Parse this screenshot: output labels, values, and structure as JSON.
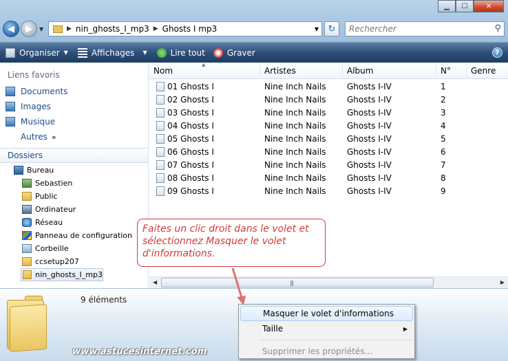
{
  "window": {
    "controls": {
      "minimize": "▁",
      "maximize": "☐",
      "close": "✕"
    }
  },
  "address": {
    "crumbs": [
      "nin_ghosts_I_mp3",
      "Ghosts I mp3"
    ]
  },
  "search": {
    "placeholder": "Rechercher"
  },
  "toolbar": {
    "organize": "Organiser",
    "views": "Affichages",
    "play_all": "Lire tout",
    "burn": "Graver",
    "help": "?"
  },
  "sidebar": {
    "favorites_title": "Liens favoris",
    "favorites": [
      "Documents",
      "Images",
      "Musique"
    ],
    "more": "Autres",
    "folders_title": "Dossiers",
    "tree": [
      {
        "label": "Bureau",
        "icon": "desktop-icon"
      },
      {
        "label": "Sebastien",
        "icon": "user-icon"
      },
      {
        "label": "Public",
        "icon": "folder-icon"
      },
      {
        "label": "Ordinateur",
        "icon": "computer-icon"
      },
      {
        "label": "Réseau",
        "icon": "network-icon"
      },
      {
        "label": "Panneau de configuration",
        "icon": "control-panel-icon"
      },
      {
        "label": "Corbeille",
        "icon": "recycle-bin-icon"
      },
      {
        "label": "ccsetup207",
        "icon": "folder-icon"
      },
      {
        "label": "nin_ghosts_I_mp3",
        "icon": "folder-icon",
        "selected": true
      }
    ]
  },
  "list": {
    "columns": [
      "Nom",
      "Artistes",
      "Album",
      "N°",
      "Genre"
    ],
    "rows": [
      {
        "name": "01 Ghosts I",
        "artist": "Nine Inch Nails",
        "album": "Ghosts I-IV",
        "num": "1"
      },
      {
        "name": "02 Ghosts I",
        "artist": "Nine Inch Nails",
        "album": "Ghosts I-IV",
        "num": "2"
      },
      {
        "name": "03 Ghosts I",
        "artist": "Nine Inch Nails",
        "album": "Ghosts I-IV",
        "num": "3"
      },
      {
        "name": "04 Ghosts I",
        "artist": "Nine Inch Nails",
        "album": "Ghosts I-IV",
        "num": "4"
      },
      {
        "name": "05 Ghosts I",
        "artist": "Nine Inch Nails",
        "album": "Ghosts I-IV",
        "num": "5"
      },
      {
        "name": "06 Ghosts I",
        "artist": "Nine Inch Nails",
        "album": "Ghosts I-IV",
        "num": "6"
      },
      {
        "name": "07 Ghosts I",
        "artist": "Nine Inch Nails",
        "album": "Ghosts I-IV",
        "num": "7"
      },
      {
        "name": "08 Ghosts I",
        "artist": "Nine Inch Nails",
        "album": "Ghosts I-IV",
        "num": "8"
      },
      {
        "name": "09 Ghosts I",
        "artist": "Nine Inch Nails",
        "album": "Ghosts I-IV",
        "num": "9"
      }
    ]
  },
  "details": {
    "count": "9 éléments",
    "watermark": "www.astucesinternet.com"
  },
  "callout": {
    "text": "Faites un clic droit dans le volet et sélectionnez Masquer le volet d'informations."
  },
  "context_menu": {
    "items": [
      {
        "label": "Masquer le volet d'informations",
        "highlighted": true
      },
      {
        "label": "Taille",
        "submenu": true
      },
      {
        "label": "Supprimer les propriétés...",
        "disabled": true
      }
    ]
  },
  "colors": {
    "toolbar": "#2d4f78",
    "callout": "#d13a3a",
    "link": "#1e4b8c"
  }
}
